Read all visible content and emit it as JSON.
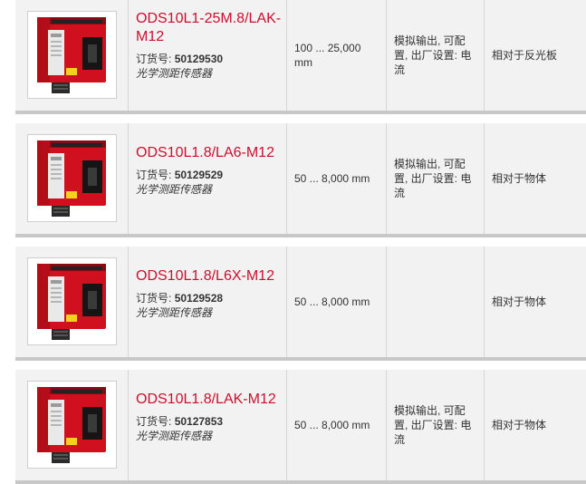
{
  "products": [
    {
      "name": "ODS10L1-25M.8/LAK-M12",
      "order_label": "订货号:",
      "order_number": "50129530",
      "type": "光学测距传感器",
      "range": "100 ... 25,000 mm",
      "output": "模拟输出, 可配置, 出厂设置: 电流",
      "reference": "相对于反光板"
    },
    {
      "name": "ODS10L1.8/LA6-M12",
      "order_label": "订货号:",
      "order_number": "50129529",
      "type": "光学测距传感器",
      "range": "50 ... 8,000 mm",
      "output": "模拟输出, 可配置, 出厂设置: 电流",
      "reference": "相对于物体"
    },
    {
      "name": "ODS10L1.8/L6X-M12",
      "order_label": "订货号:",
      "order_number": "50129528",
      "type": "光学测距传感器",
      "range": "50 ... 8,000 mm",
      "output": "",
      "reference": "相对于物体"
    },
    {
      "name": "ODS10L1.8/LAK-M12",
      "order_label": "订货号:",
      "order_number": "50127853",
      "type": "光学测距传感器",
      "range": "50 ... 8,000 mm",
      "output": "模拟输出, 可配置, 出厂设置: 电流",
      "reference": "相对于物体"
    }
  ],
  "colors": {
    "accent": "#cc0f2e",
    "row_bg": "#f2f2f2",
    "separator": "#c8c8c8"
  },
  "icons": {
    "product": "ods10-sensor-photo"
  }
}
